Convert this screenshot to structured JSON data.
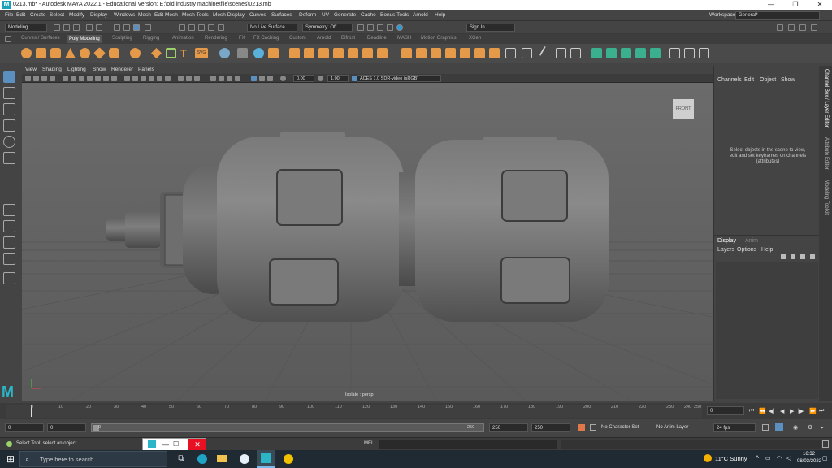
{
  "title": {
    "text": "0213.mb* - Autodesk MAYA 2022.1 - Educational Version: E:\\old industry machine\\file\\scenes\\0213.mb",
    "minimize": "—",
    "maximize": "❐",
    "close": "✕"
  },
  "menu": [
    "File",
    "Edit",
    "Create",
    "Select",
    "Modify",
    "Display",
    "Windows",
    "Mesh",
    "Edit Mesh",
    "Mesh Tools",
    "Mesh Display",
    "Curves",
    "Surfaces",
    "Deform",
    "UV",
    "Generate",
    "Cache",
    "Bonus Tools",
    "Arnold",
    "Help"
  ],
  "workspace": {
    "label": "Workspace :",
    "value": "General*"
  },
  "status": {
    "mode": "Modeling",
    "live_surface": "No Live Surface",
    "symmetry": "Symmetry: Off",
    "sign_in": "Sign In"
  },
  "shelf_tabs": [
    "Curves / Surfaces",
    "Poly Modeling",
    "Sculpting",
    "Rigging",
    "Animation",
    "Rendering",
    "FX",
    "FX Caching",
    "Custom",
    "Arnold",
    "Bifrost",
    "Deadline",
    "MASH",
    "Motion Graphics",
    "XGen"
  ],
  "shelf_active": "Poly Modeling",
  "panel_menu": [
    "View",
    "Shading",
    "Lighting",
    "Show",
    "Renderer",
    "Panels"
  ],
  "panel_bar": {
    "exposure": "0.00",
    "gamma": "1.00",
    "colorspace": "ACES 1.0 SDR-video (sRGB)"
  },
  "viewport": {
    "view_cube": "FRONT",
    "camera_label": "Isolate : persp"
  },
  "channel_box": {
    "menu": [
      "Channels",
      "Edit",
      "Object",
      "Show"
    ],
    "message": "Select objects in the scene to view, edit and set keyframes on channels (attributes)",
    "tabs": [
      "Display",
      "Anim"
    ],
    "layer_menu": [
      "Layers",
      "Options",
      "Help"
    ]
  },
  "side_tabs": [
    "Channel Box / Layer Editor",
    "Attribute Editor",
    "Modeling Toolkit"
  ],
  "time_slider": {
    "ticks": [
      "0",
      "10",
      "20",
      "30",
      "40",
      "50",
      "60",
      "70",
      "80",
      "90",
      "100",
      "110",
      "120",
      "130",
      "140",
      "150",
      "160",
      "170",
      "180",
      "190",
      "200",
      "210",
      "220",
      "230",
      "240",
      "250"
    ],
    "current": "0"
  },
  "range": {
    "start": "0",
    "anim_start": "0",
    "range_end": "250",
    "anim_end": "250",
    "end": "250",
    "end2": "250",
    "character_set": "No Character Set",
    "anim_layer": "No Anim Layer",
    "fps": "24 fps"
  },
  "command": {
    "help": "Select Tool: select an object",
    "lang": "MEL"
  },
  "taskbar": {
    "search": "Type here to search",
    "weather": "11°C  Sunny",
    "time": "16:32",
    "date": "08/03/2022"
  }
}
